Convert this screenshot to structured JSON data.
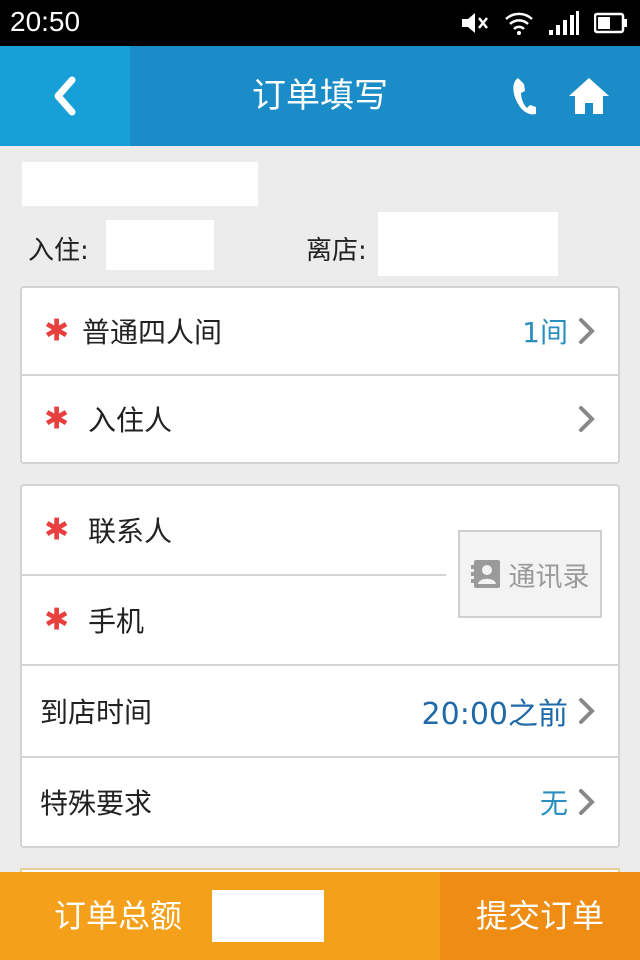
{
  "status_bar": {
    "time": "20:50"
  },
  "nav": {
    "title": "订单填写"
  },
  "stay": {
    "checkin_label": "入住:",
    "checkout_label": "离店:"
  },
  "room_section": {
    "room_type": "普通四人间",
    "room_count": "1间",
    "guest_label": "入住人"
  },
  "contact_section": {
    "contact_label": "联系人",
    "phone_label": "手机",
    "address_book_label": "通讯录",
    "arrival_label": "到店时间",
    "arrival_value": "20:00之前",
    "request_label": "特殊要求",
    "request_value": "无"
  },
  "footer": {
    "total_label": "订单总额",
    "submit_label": "提交订单"
  },
  "colors": {
    "nav_bg": "#1a8cc7",
    "back_bg": "#17a0d8",
    "required_star": "#e8403f",
    "value_blue": "#2a8fbf",
    "arrival_blue": "#1f6aa8",
    "footer_orange": "#f5a01a",
    "submit_orange": "#ef8c13"
  }
}
